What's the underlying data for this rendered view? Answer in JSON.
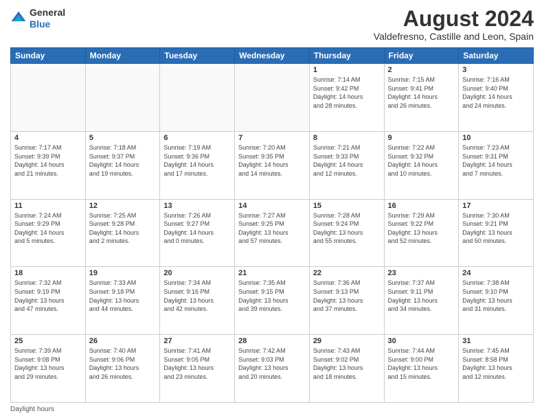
{
  "logo": {
    "general": "General",
    "blue": "Blue"
  },
  "title": "August 2024",
  "subtitle": "Valdefresno, Castille and Leon, Spain",
  "days_of_week": [
    "Sunday",
    "Monday",
    "Tuesday",
    "Wednesday",
    "Thursday",
    "Friday",
    "Saturday"
  ],
  "footer": "Daylight hours",
  "weeks": [
    [
      {
        "day": "",
        "info": ""
      },
      {
        "day": "",
        "info": ""
      },
      {
        "day": "",
        "info": ""
      },
      {
        "day": "",
        "info": ""
      },
      {
        "day": "1",
        "info": "Sunrise: 7:14 AM\nSunset: 9:42 PM\nDaylight: 14 hours\nand 28 minutes."
      },
      {
        "day": "2",
        "info": "Sunrise: 7:15 AM\nSunset: 9:41 PM\nDaylight: 14 hours\nand 26 minutes."
      },
      {
        "day": "3",
        "info": "Sunrise: 7:16 AM\nSunset: 9:40 PM\nDaylight: 14 hours\nand 24 minutes."
      }
    ],
    [
      {
        "day": "4",
        "info": "Sunrise: 7:17 AM\nSunset: 9:39 PM\nDaylight: 14 hours\nand 21 minutes."
      },
      {
        "day": "5",
        "info": "Sunrise: 7:18 AM\nSunset: 9:37 PM\nDaylight: 14 hours\nand 19 minutes."
      },
      {
        "day": "6",
        "info": "Sunrise: 7:19 AM\nSunset: 9:36 PM\nDaylight: 14 hours\nand 17 minutes."
      },
      {
        "day": "7",
        "info": "Sunrise: 7:20 AM\nSunset: 9:35 PM\nDaylight: 14 hours\nand 14 minutes."
      },
      {
        "day": "8",
        "info": "Sunrise: 7:21 AM\nSunset: 9:33 PM\nDaylight: 14 hours\nand 12 minutes."
      },
      {
        "day": "9",
        "info": "Sunrise: 7:22 AM\nSunset: 9:32 PM\nDaylight: 14 hours\nand 10 minutes."
      },
      {
        "day": "10",
        "info": "Sunrise: 7:23 AM\nSunset: 9:31 PM\nDaylight: 14 hours\nand 7 minutes."
      }
    ],
    [
      {
        "day": "11",
        "info": "Sunrise: 7:24 AM\nSunset: 9:29 PM\nDaylight: 14 hours\nand 5 minutes."
      },
      {
        "day": "12",
        "info": "Sunrise: 7:25 AM\nSunset: 9:28 PM\nDaylight: 14 hours\nand 2 minutes."
      },
      {
        "day": "13",
        "info": "Sunrise: 7:26 AM\nSunset: 9:27 PM\nDaylight: 14 hours\nand 0 minutes."
      },
      {
        "day": "14",
        "info": "Sunrise: 7:27 AM\nSunset: 9:25 PM\nDaylight: 13 hours\nand 57 minutes."
      },
      {
        "day": "15",
        "info": "Sunrise: 7:28 AM\nSunset: 9:24 PM\nDaylight: 13 hours\nand 55 minutes."
      },
      {
        "day": "16",
        "info": "Sunrise: 7:29 AM\nSunset: 9:22 PM\nDaylight: 13 hours\nand 52 minutes."
      },
      {
        "day": "17",
        "info": "Sunrise: 7:30 AM\nSunset: 9:21 PM\nDaylight: 13 hours\nand 50 minutes."
      }
    ],
    [
      {
        "day": "18",
        "info": "Sunrise: 7:32 AM\nSunset: 9:19 PM\nDaylight: 13 hours\nand 47 minutes."
      },
      {
        "day": "19",
        "info": "Sunrise: 7:33 AM\nSunset: 9:18 PM\nDaylight: 13 hours\nand 44 minutes."
      },
      {
        "day": "20",
        "info": "Sunrise: 7:34 AM\nSunset: 9:16 PM\nDaylight: 13 hours\nand 42 minutes."
      },
      {
        "day": "21",
        "info": "Sunrise: 7:35 AM\nSunset: 9:15 PM\nDaylight: 13 hours\nand 39 minutes."
      },
      {
        "day": "22",
        "info": "Sunrise: 7:36 AM\nSunset: 9:13 PM\nDaylight: 13 hours\nand 37 minutes."
      },
      {
        "day": "23",
        "info": "Sunrise: 7:37 AM\nSunset: 9:11 PM\nDaylight: 13 hours\nand 34 minutes."
      },
      {
        "day": "24",
        "info": "Sunrise: 7:38 AM\nSunset: 9:10 PM\nDaylight: 13 hours\nand 31 minutes."
      }
    ],
    [
      {
        "day": "25",
        "info": "Sunrise: 7:39 AM\nSunset: 9:08 PM\nDaylight: 13 hours\nand 29 minutes."
      },
      {
        "day": "26",
        "info": "Sunrise: 7:40 AM\nSunset: 9:06 PM\nDaylight: 13 hours\nand 26 minutes."
      },
      {
        "day": "27",
        "info": "Sunrise: 7:41 AM\nSunset: 9:05 PM\nDaylight: 13 hours\nand 23 minutes."
      },
      {
        "day": "28",
        "info": "Sunrise: 7:42 AM\nSunset: 9:03 PM\nDaylight: 13 hours\nand 20 minutes."
      },
      {
        "day": "29",
        "info": "Sunrise: 7:43 AM\nSunset: 9:02 PM\nDaylight: 13 hours\nand 18 minutes."
      },
      {
        "day": "30",
        "info": "Sunrise: 7:44 AM\nSunset: 9:00 PM\nDaylight: 13 hours\nand 15 minutes."
      },
      {
        "day": "31",
        "info": "Sunrise: 7:45 AM\nSunset: 8:58 PM\nDaylight: 13 hours\nand 12 minutes."
      }
    ]
  ]
}
